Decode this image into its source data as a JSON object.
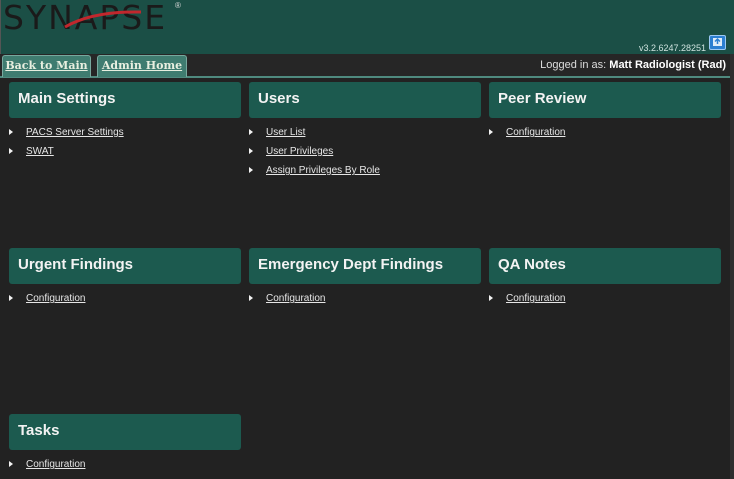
{
  "header": {
    "logo_text": "SYNAPSE",
    "logo_reg": "®",
    "version": "v3.2.6247.28251"
  },
  "tabs": [
    {
      "label": "Back to Main"
    },
    {
      "label": "Admin Home"
    }
  ],
  "login": {
    "prefix": "Logged in as:",
    "user": "Matt Radiologist (Rad)"
  },
  "panels": {
    "main_settings": {
      "title": "Main Settings",
      "links": [
        "PACS Server Settings",
        "SWAT"
      ]
    },
    "users": {
      "title": "Users",
      "links": [
        "User List",
        "User Privileges",
        "Assign Privileges By Role"
      ]
    },
    "peer_review": {
      "title": "Peer Review",
      "links": [
        "Configuration"
      ]
    },
    "urgent_findings": {
      "title": "Urgent Findings",
      "links": [
        "Configuration"
      ]
    },
    "emergency_dept": {
      "title": "Emergency Dept Findings",
      "links": [
        "Configuration"
      ]
    },
    "qa_notes": {
      "title": "QA Notes",
      "links": [
        "Configuration"
      ]
    },
    "tasks": {
      "title": "Tasks",
      "links": [
        "Configuration"
      ]
    }
  },
  "colors": {
    "header_bg": "#1b4f46",
    "panel_title_bg": "#1c5a4f",
    "tab_bg": "#3f7c70",
    "page_bg": "#222222"
  },
  "icons": [
    "help-icon",
    "bullet-arrow-icon"
  ]
}
